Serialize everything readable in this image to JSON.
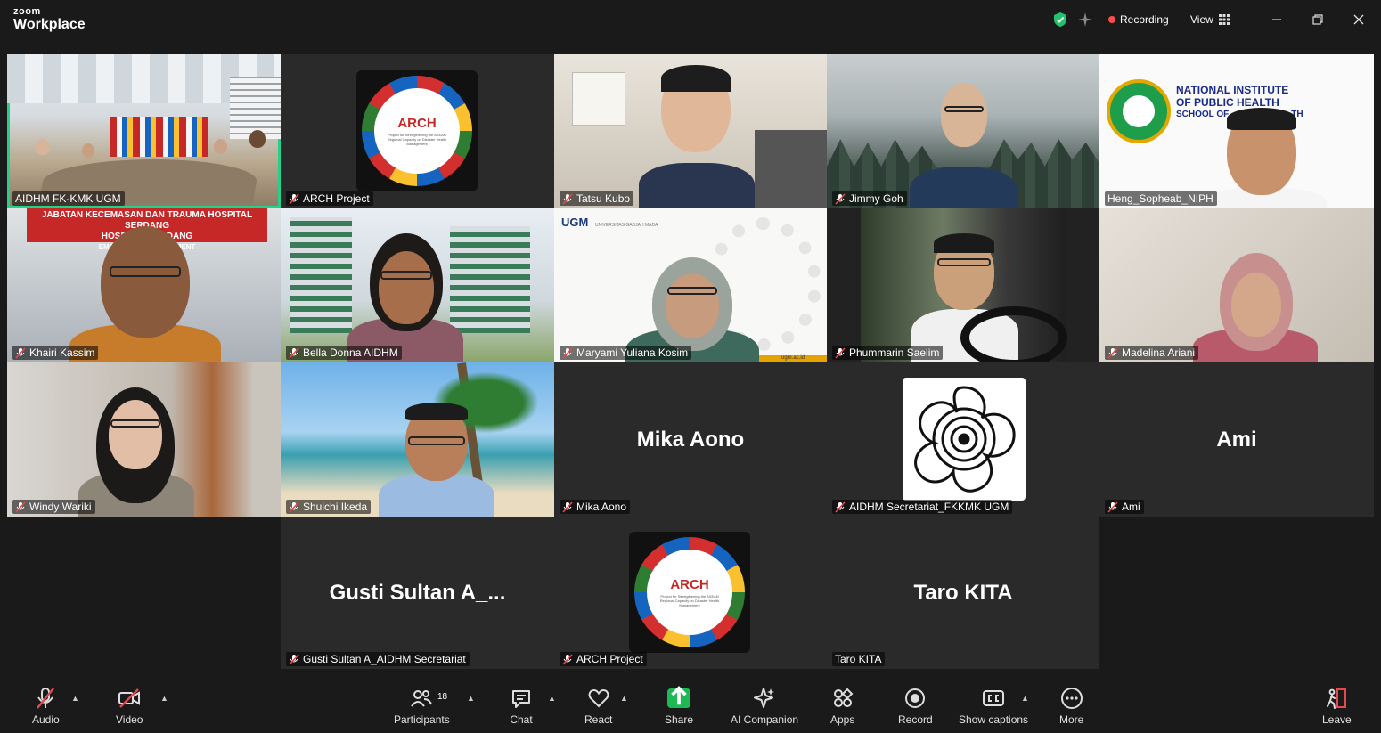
{
  "app": {
    "brand_top": "zoom",
    "brand_bottom": "Workplace"
  },
  "titlebar": {
    "recording": "Recording",
    "view": "View"
  },
  "tiles": {
    "t1": "AIDHM FK-KMK UGM",
    "t2": "ARCH Project",
    "t3": "Tatsu Kubo",
    "t4": "Jimmy Goh",
    "t5": "Heng_Sopheab_NIPH",
    "t6": "Khairi Kassim",
    "t7": "Bella Donna AIDHM",
    "t8": "Maryami Yuliana Kosim",
    "t9": "Phummarin Saelim",
    "t10": "Madelina Ariani",
    "t11": "Windy Wariki",
    "t12": "Shuichi Ikeda",
    "t13": "Mika Aono",
    "t13_big": "Mika Aono",
    "t14": "AIDHM Secretariat_FKKMK UGM",
    "t15": "Ami",
    "t15_big": "Ami",
    "t16": "Gusti Sultan A_AIDHM Secretariat",
    "t16_big": "Gusti Sultan A_...",
    "t17": "ARCH Project",
    "t18": "Taro KITA",
    "t18_big": "Taro KITA"
  },
  "tile_text": {
    "arch": "ARCH",
    "arch_sub": "Project for Strengthening the ASEAN Regional Capacity on Disaster Health Management",
    "niph_l1": "NATIONAL INSTITUTE",
    "niph_l2": "OF PUBLIC HEALTH",
    "niph_l3": "SCHOOL OF",
    "niph_l3b": "TH",
    "hospital_l1": "JABATAN KECEMASAN DAN TRAUMA HOSPITAL SERDANG",
    "hospital_l2": "HOSPITAL SERDANG",
    "hospital_l3": "EMERGENCY DEPARTMENT",
    "ugm": "UGM",
    "ugm_sub": "UNIVERSITAS GADJAH MADA",
    "ugm_url": "ugm.ac.id"
  },
  "toolbar": {
    "audio": "Audio",
    "video": "Video",
    "participants": "Participants",
    "participants_count": "18",
    "chat": "Chat",
    "react": "React",
    "share": "Share",
    "ai": "AI Companion",
    "apps": "Apps",
    "record": "Record",
    "captions": "Show captions",
    "more": "More",
    "leave": "Leave"
  },
  "colors": {
    "active_border": "#23d18b",
    "share_green": "#1db954",
    "recording_red": "#ff4d4f",
    "leave_red": "#e5484d"
  }
}
